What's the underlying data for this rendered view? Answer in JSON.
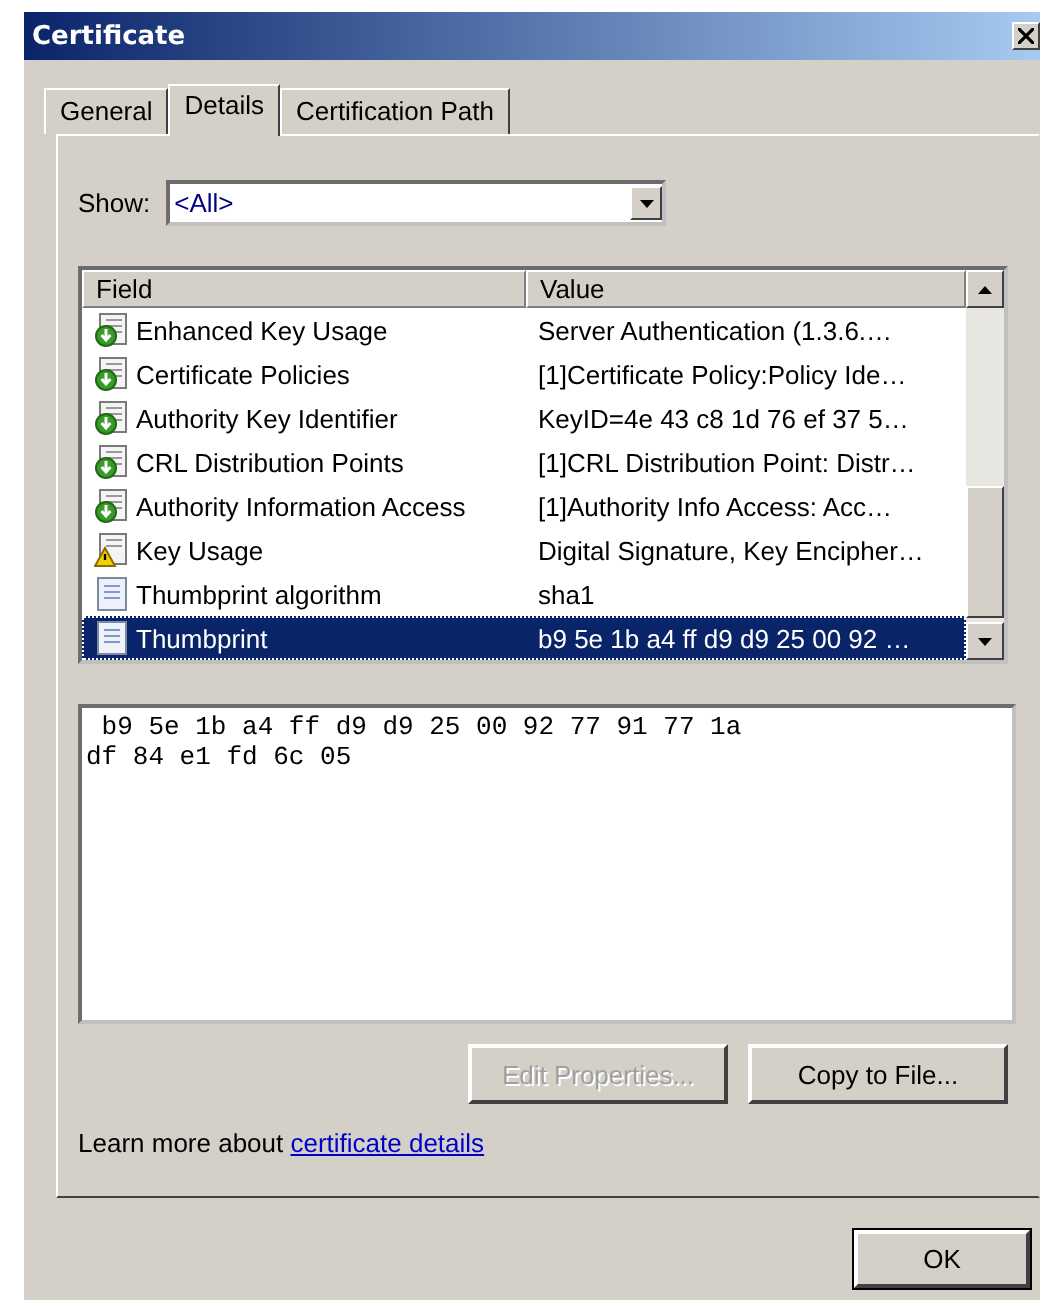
{
  "window": {
    "title": "Certificate"
  },
  "tabs": [
    {
      "label": "General",
      "selected": false
    },
    {
      "label": "Details",
      "selected": true
    },
    {
      "label": "Certification Path",
      "selected": false
    }
  ],
  "show": {
    "label": "Show:",
    "value": "<All>"
  },
  "table": {
    "columns": [
      "Field",
      "Value"
    ],
    "rows": [
      {
        "kind": "extension",
        "field": "Enhanced Key Usage",
        "value": "Server Authentication (1.3.6.…",
        "selected": false
      },
      {
        "kind": "extension",
        "field": "Certificate Policies",
        "value": "[1]Certificate Policy:Policy Ide…",
        "selected": false
      },
      {
        "kind": "extension",
        "field": "Authority Key Identifier",
        "value": "KeyID=4e 43 c8 1d 76 ef 37 5…",
        "selected": false
      },
      {
        "kind": "extension",
        "field": "CRL Distribution Points",
        "value": "[1]CRL Distribution Point: Distr…",
        "selected": false
      },
      {
        "kind": "extension",
        "field": "Authority Information Access",
        "value": "[1]Authority Info Access: Acc…",
        "selected": false
      },
      {
        "kind": "warning",
        "field": "Key Usage",
        "value": "Digital Signature, Key Encipher…",
        "selected": false
      },
      {
        "kind": "property",
        "field": "Thumbprint algorithm",
        "value": "sha1",
        "selected": false
      },
      {
        "kind": "property",
        "field": "Thumbprint",
        "value": "b9 5e 1b a4 ff d9 d9 25 00 92 …",
        "selected": true
      }
    ]
  },
  "detail_text": " b9 5e 1b a4 ff d9 d9 25 00 92 77 91 77 1a\ndf 84 e1 fd 6c 05",
  "buttons": [
    {
      "label": "Edit Properties...",
      "disabled": true
    },
    {
      "label": "Copy to File...",
      "disabled": false
    }
  ],
  "learn_more": {
    "text": "Learn more about ",
    "link": "certificate details"
  },
  "ok_button": "OK"
}
